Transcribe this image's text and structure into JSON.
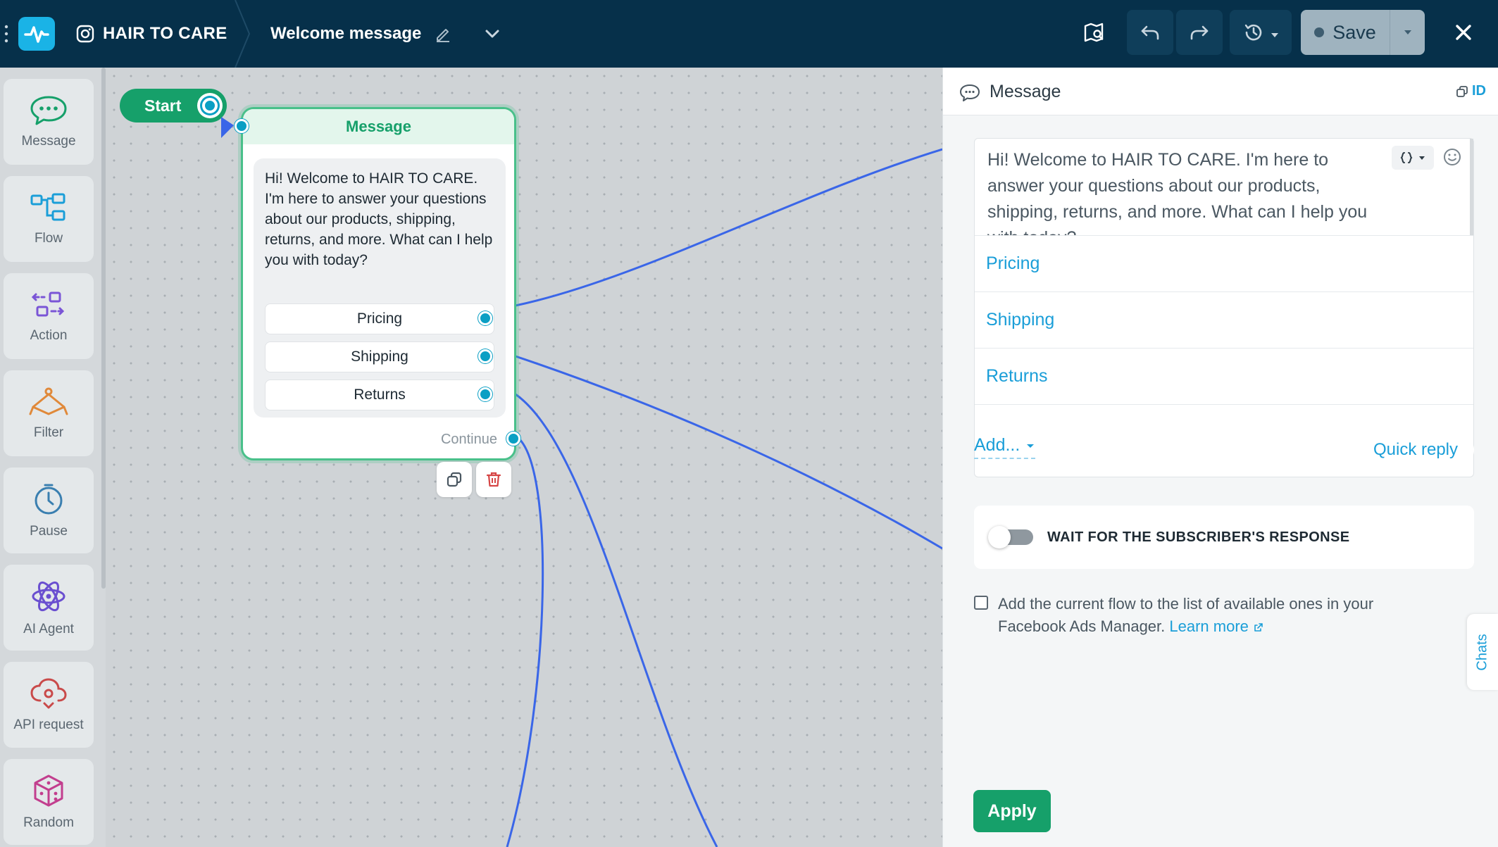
{
  "header": {
    "bot_name": "HAIR TO CARE",
    "flow_title": "Welcome message",
    "save_label": "Save"
  },
  "sidebar": {
    "items": [
      {
        "label": "Message",
        "icon": "chat-bubble-icon"
      },
      {
        "label": "Flow",
        "icon": "flow-icon"
      },
      {
        "label": "Action",
        "icon": "action-icon"
      },
      {
        "label": "Filter",
        "icon": "filter-icon"
      },
      {
        "label": "Pause",
        "icon": "clock-icon"
      },
      {
        "label": "AI Agent",
        "icon": "ai-agent-icon"
      },
      {
        "label": "API request",
        "icon": "cloud-icon"
      },
      {
        "label": "Random",
        "icon": "dice-icon"
      }
    ]
  },
  "canvas": {
    "start_label": "Start",
    "node": {
      "title": "Message",
      "text": "Hi! Welcome to HAIR TO CARE. I'm here to answer your questions about our products, shipping, returns, and more. What can I help you with today?",
      "quick_replies": [
        "Pricing",
        "Shipping",
        "Returns"
      ],
      "continue_label": "Continue"
    }
  },
  "panel": {
    "title": "Message",
    "id_label": "ID",
    "message_text": "Hi! Welcome to HAIR TO CARE. I'm here to answer your questions about our products, shipping, returns, and more. What can I help you with today?",
    "replies": [
      "Pricing",
      "Shipping",
      "Returns"
    ],
    "add_label": "Add...",
    "quick_reply_label": "Quick reply",
    "wait_label": "WAIT FOR THE SUBSCRIBER'S RESPONSE",
    "wait_enabled": false,
    "fb_text": "Add the current flow to the list of available ones in your Facebook Ads Manager.",
    "fb_link": "Learn more",
    "apply_label": "Apply"
  },
  "chats_tab": "Chats",
  "colors": {
    "topbar": "#06304a",
    "accent_green": "#16a06a",
    "accent_blue": "#1a9ed8",
    "connector": "#3a66e8"
  }
}
